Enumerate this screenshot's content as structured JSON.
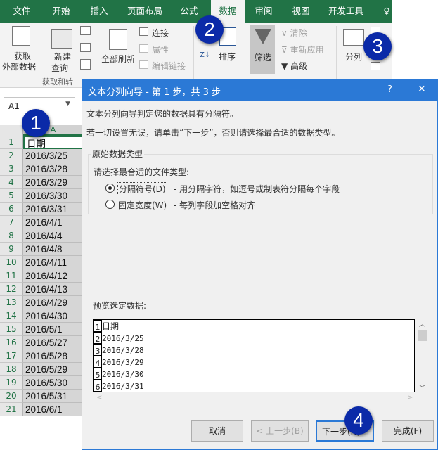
{
  "ribbon": {
    "tabs": [
      "文件",
      "开始",
      "插入",
      "页面布局",
      "公式",
      "数据",
      "审阅",
      "视图",
      "开发工具"
    ],
    "active_tab": "数据",
    "get_external": [
      "获取",
      "外部数据"
    ],
    "new_query": [
      "新建",
      "查询"
    ],
    "refresh_all": "全部刷新",
    "connections": "连接",
    "properties": "属性",
    "edit_links": "编辑链接",
    "sort": "排序",
    "filter": "筛选",
    "clear": "清除",
    "reapply": "重新应用",
    "advanced": "高级",
    "text_to_columns": "分列",
    "group_label": "获取和转"
  },
  "sheet": {
    "name_box": "A1",
    "column": "A",
    "rows": [
      "日期",
      "2016/3/25",
      "2016/3/28",
      "2016/3/29",
      "2016/3/30",
      "2016/3/31",
      "2016/4/1",
      "2016/4/4",
      "2016/4/8",
      "2016/4/11",
      "2016/4/12",
      "2016/4/13",
      "2016/4/29",
      "2016/4/30",
      "2016/5/1",
      "2016/5/27",
      "2016/5/28",
      "2016/5/29",
      "2016/5/30",
      "2016/5/31",
      "2016/6/1"
    ]
  },
  "dialog": {
    "title": "文本分列向导 - 第 1 步，共 3 步",
    "help": "?",
    "close": "✕",
    "line1": "文本分列向导判定您的数据具有分隔符。",
    "line2": "若一切设置无误，请单击“下一步”，否则请选择最合适的数据类型。",
    "group_title": "原始数据类型",
    "prompt": "请选择最合适的文件类型:",
    "options": [
      {
        "label": "分隔符号(D)",
        "desc": "- 用分隔字符，如逗号或制表符分隔每个字段",
        "selected": true
      },
      {
        "label": "固定宽度(W)",
        "desc": "- 每列字段加空格对齐",
        "selected": false
      }
    ],
    "preview_label": "预览选定数据:",
    "preview": [
      {
        "n": "1",
        "t": "日期"
      },
      {
        "n": "2",
        "t": "2016/3/25"
      },
      {
        "n": "3",
        "t": "2016/3/28"
      },
      {
        "n": "4",
        "t": "2016/3/29"
      },
      {
        "n": "5",
        "t": "2016/3/30"
      },
      {
        "n": "6",
        "t": "2016/3/31"
      }
    ],
    "buttons": {
      "cancel": "取消",
      "back": "< 上一步(B)",
      "next": "下一步(N)",
      "finish": "完成(F)"
    }
  },
  "badges": [
    "1",
    "2",
    "3",
    "4"
  ],
  "colors": {
    "excel_green": "#217346",
    "dialog_blue": "#2b79d6",
    "badge": "#0b2aa8"
  }
}
